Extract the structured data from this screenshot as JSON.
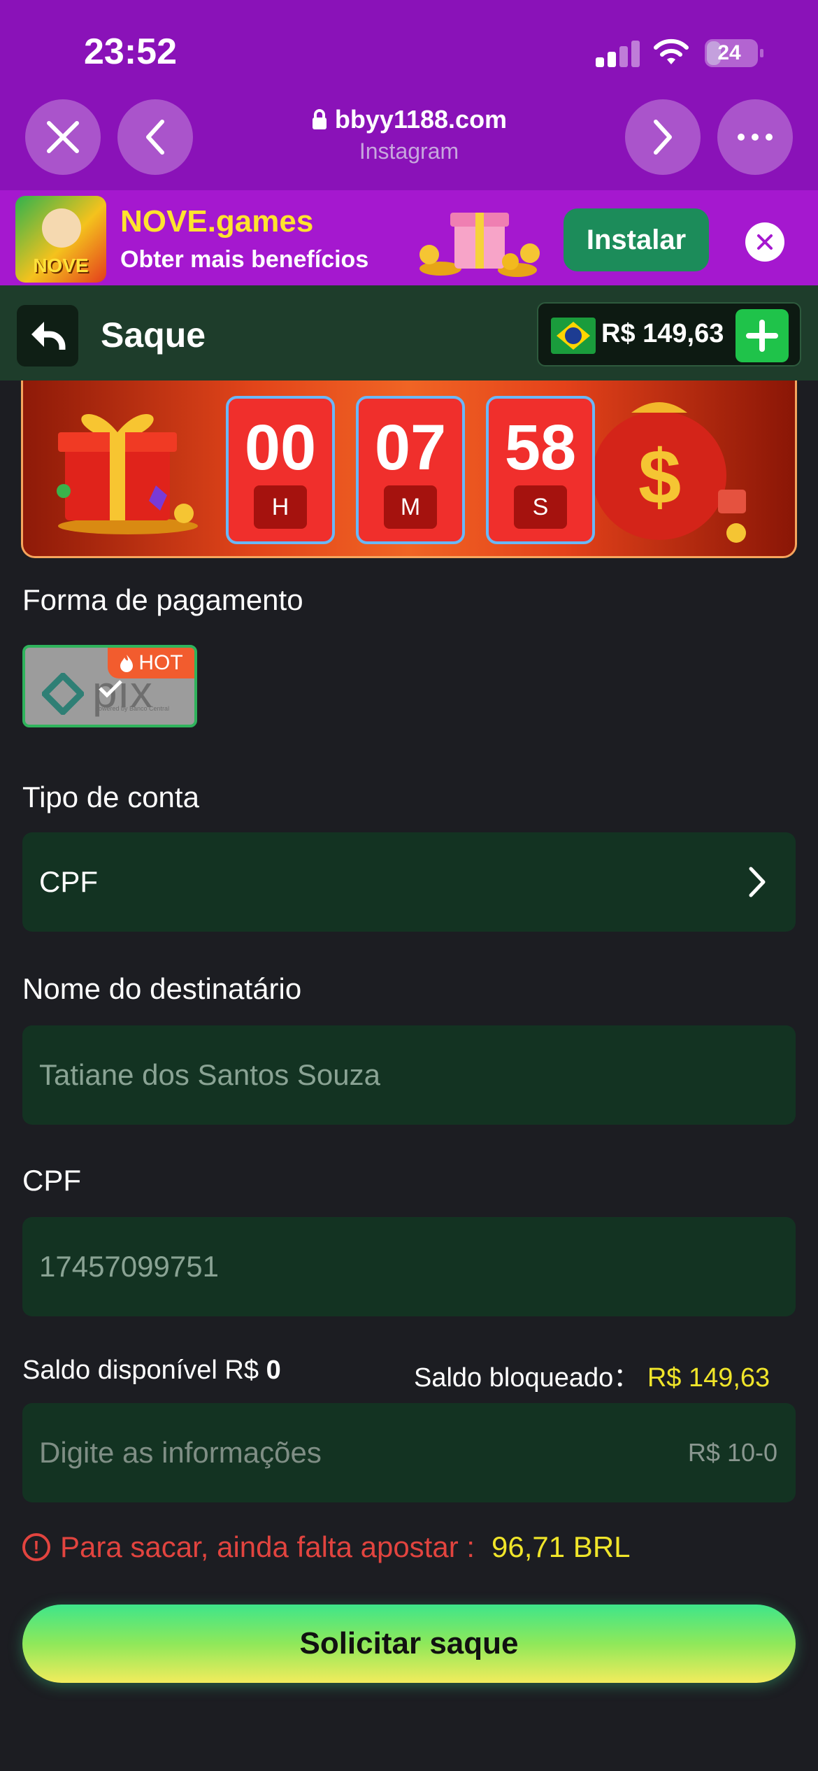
{
  "status_bar": {
    "time": "23:52",
    "battery": "24"
  },
  "browser": {
    "url": "bbyy1188.com",
    "source": "Instagram"
  },
  "promo": {
    "title": "NOVE.games",
    "subtitle": "Obter mais benefícios",
    "logo_text": "NOVE",
    "install_label": "Instalar"
  },
  "header": {
    "title": "Saque",
    "balance": "R$ 149,63"
  },
  "countdown": [
    {
      "value": "00",
      "unit": "H"
    },
    {
      "value": "07",
      "unit": "M"
    },
    {
      "value": "58",
      "unit": "S"
    }
  ],
  "form": {
    "payment_label": "Forma de pagamento",
    "payment_method": {
      "name": "pix",
      "badge": "HOT",
      "fine_print": "powered by Banco Central"
    },
    "account_type_label": "Tipo de conta",
    "account_type_value": "CPF",
    "recipient_label": "Nome do destinatário",
    "recipient_value": "Tatiane dos Santos Souza",
    "cpf_label": "CPF",
    "cpf_value": "17457099751",
    "available_prefix": "Saldo disponível R$",
    "available_value": "0",
    "blocked_label": "Saldo bloqueado：",
    "blocked_value": "R$ 149,63",
    "amount_placeholder": "Digite as informações",
    "amount_range": "R$ 10-0",
    "warning_text": "Para sacar, ainda falta apostar :",
    "warning_value": "96,71 BRL",
    "submit_label": "Solicitar saque"
  },
  "colors": {
    "brand_purple": "#8a12b8",
    "header_green": "#1e3d2b",
    "field_bg": "#133322",
    "accent_yellow": "#f0e52a",
    "warn_red": "#e2443f"
  }
}
